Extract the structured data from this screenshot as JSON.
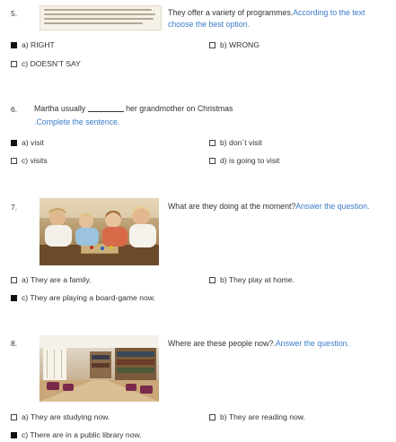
{
  "questions": [
    {
      "number": "5.",
      "stem": "They offer a variety of programmes.",
      "instruction": "According to the text choose the best option.",
      "options": [
        {
          "letter": "a)",
          "text": "RIGHT",
          "checked": true
        },
        {
          "letter": "b)",
          "text": "WRONG",
          "checked": false
        },
        {
          "letter": "c)",
          "text": "DOESN'T SAY",
          "checked": false
        }
      ]
    },
    {
      "number": "6.",
      "stem_before": "Martha usually",
      "stem_after": "her grandmother on Christmas",
      "instruction": ".Complete the sentence.",
      "options": [
        {
          "letter": "a)",
          "text": "visit",
          "checked": true
        },
        {
          "letter": "b)",
          "text": "don`t visit",
          "checked": false
        },
        {
          "letter": "c)",
          "text": "visits",
          "checked": false
        },
        {
          "letter": "d)",
          "text": "is going to visit",
          "checked": false
        }
      ]
    },
    {
      "number": "7.",
      "stem": "What are they doing at the moment?",
      "instruction": "Answer the question.",
      "options": [
        {
          "letter": "a)",
          "text": "They are a family.",
          "checked": false
        },
        {
          "letter": "b)",
          "text": "They play at home.",
          "checked": false
        },
        {
          "letter": "c)",
          "text": "They are playing a board-game now.",
          "checked": true
        }
      ]
    },
    {
      "number": "8.",
      "stem": "Where are these people now?.",
      "instruction": "Answer the question.",
      "options": [
        {
          "letter": "a)",
          "text": "They are studying now.",
          "checked": false
        },
        {
          "letter": "b)",
          "text": "They are reading now.",
          "checked": false
        },
        {
          "letter": "c)",
          "text": "There are in a public library now.",
          "checked": true
        }
      ]
    }
  ],
  "colors": {
    "instruction": "#3a7bc8",
    "checked": "#111111",
    "text": "#333333"
  },
  "images": {
    "q5": "text-passage-thumbnail",
    "q7": "family-board-game-photo",
    "q8": "library-interior-photo"
  }
}
